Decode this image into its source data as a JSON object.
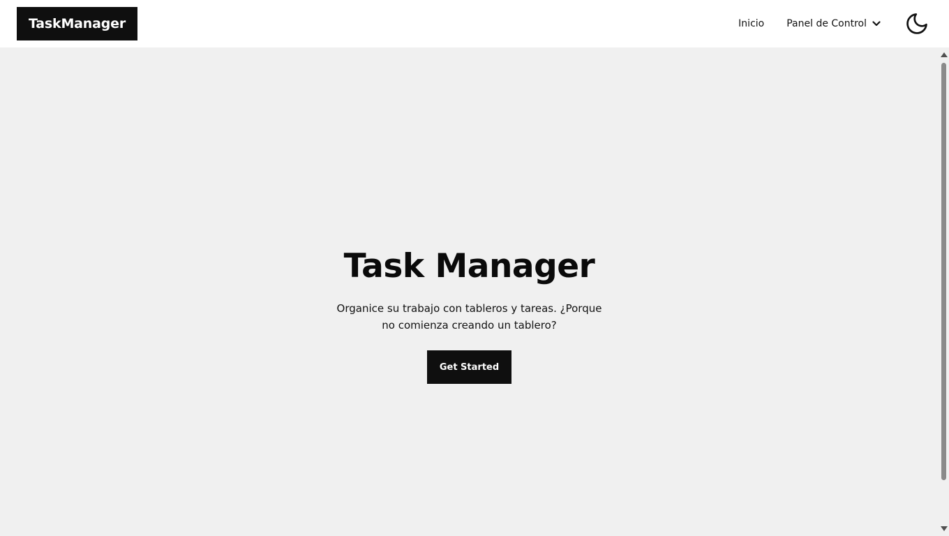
{
  "navbar": {
    "brand": "TaskManager",
    "links": {
      "home": "Inicio",
      "dashboard": "Panel de Control"
    },
    "icons": {
      "dropdown": "chevron-down-icon",
      "theme": "moon-icon"
    }
  },
  "hero": {
    "title": "Task Manager",
    "subtitle": "Organice su trabajo con tableros y tareas. ¿Porque no comienza creando un tablero?",
    "cta_label": "Get Started"
  },
  "colors": {
    "brand_bg": "#0f0f0f",
    "page_bg": "#f0f0f0",
    "navbar_bg": "#ffffff"
  }
}
